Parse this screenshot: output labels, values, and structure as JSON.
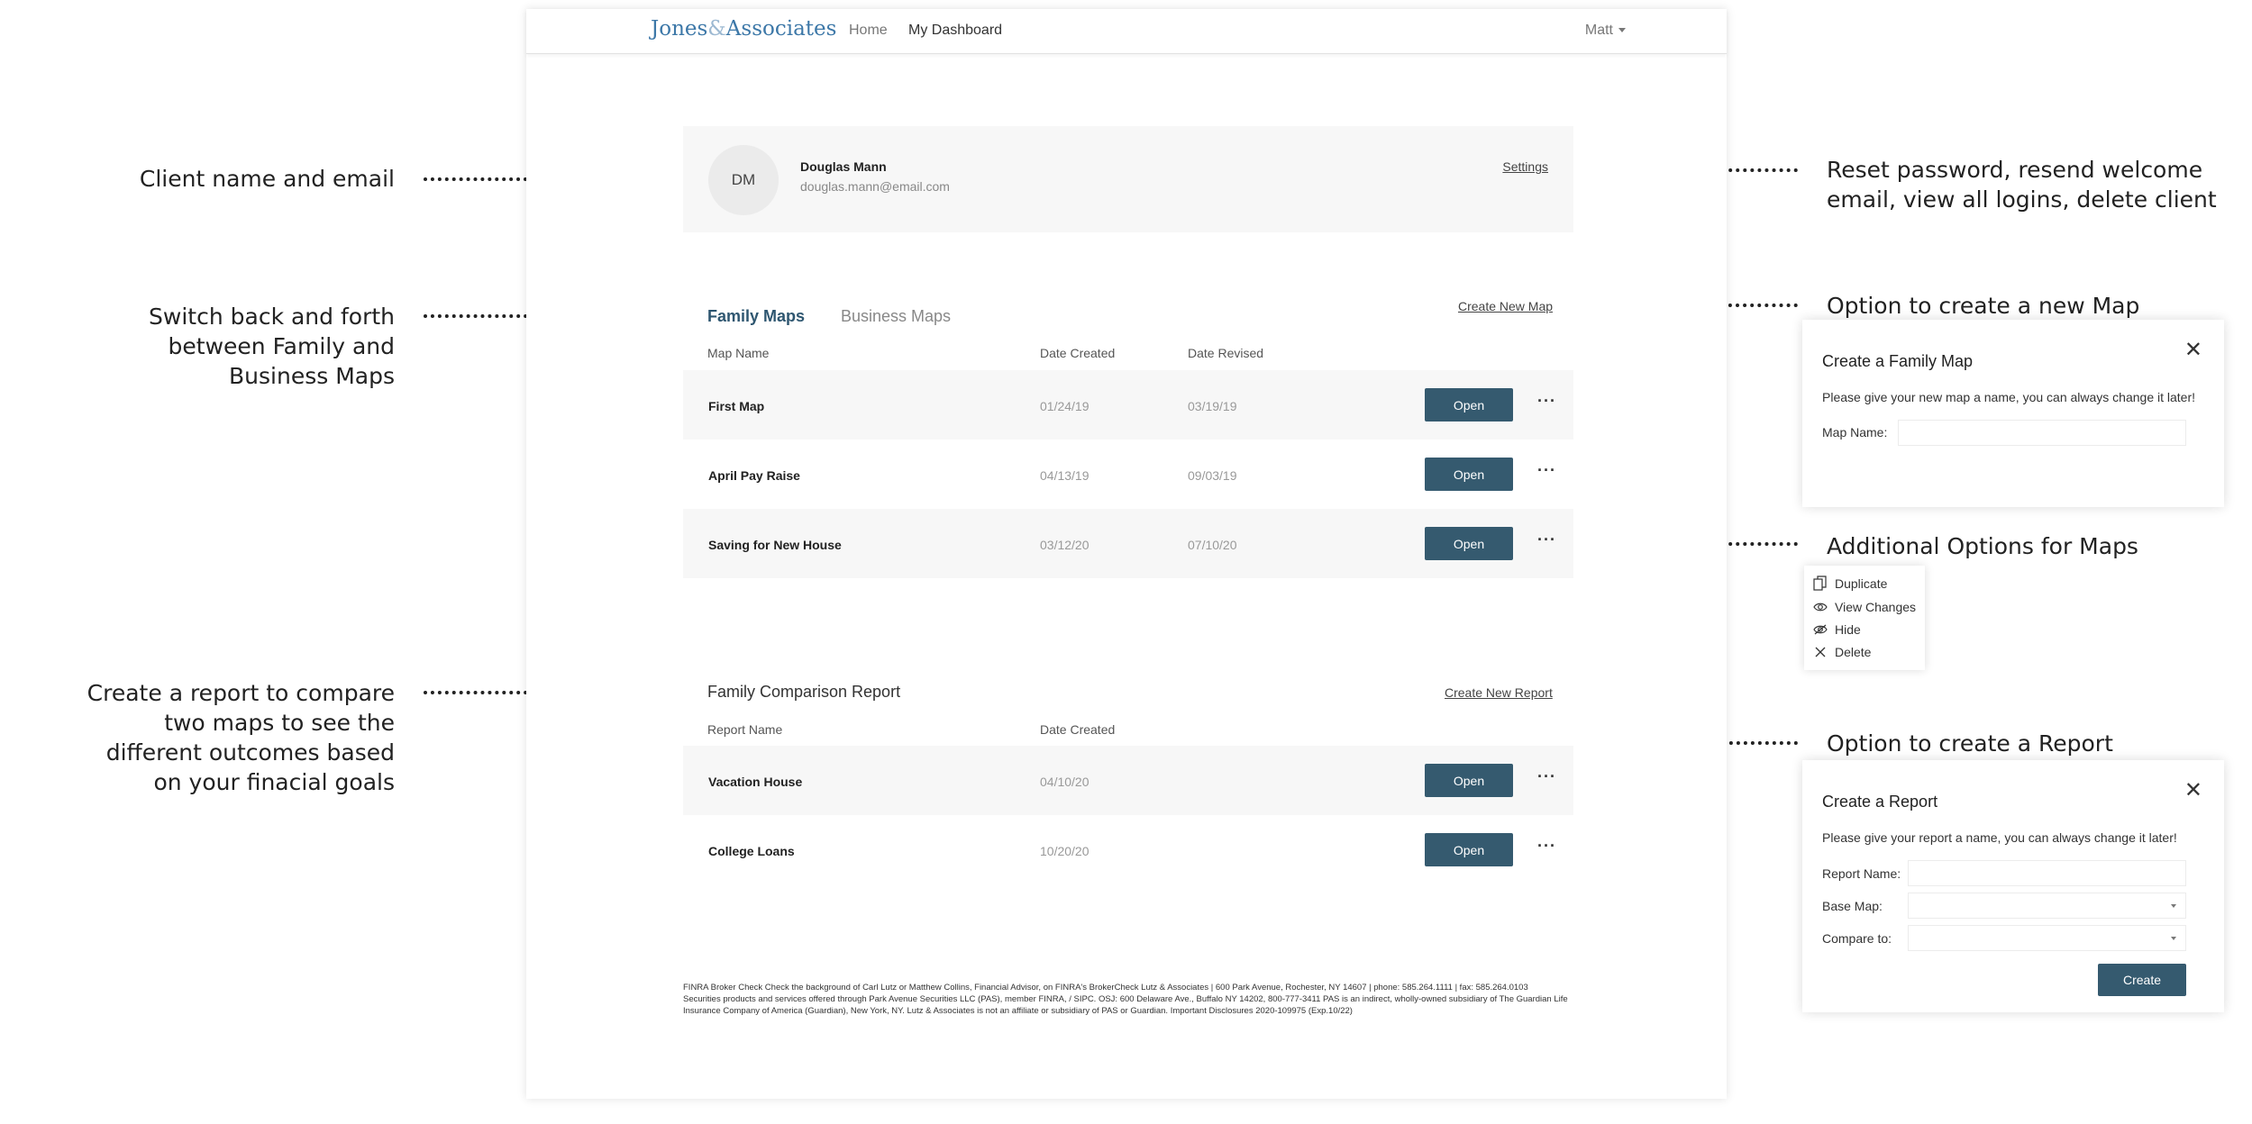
{
  "annotations": {
    "client": "Client name and email",
    "switch": [
      "Switch back and forth",
      "between Family and",
      "Business Maps"
    ],
    "report": [
      "Create a report to compare",
      "two maps to see the",
      "different outcomes based",
      "on your finacial goals"
    ],
    "settings": [
      "Reset password, resend welcome",
      "email, view all logins, delete client"
    ],
    "new_map": "Option to create a new Map",
    "options": "Additional Options for Maps",
    "new_report": "Option to create a Report"
  },
  "header": {
    "logo_left": "Jones",
    "logo_amp": "&",
    "logo_right": "Associates",
    "nav_home": "Home",
    "nav_dashboard": "My Dashboard",
    "user": "Matt"
  },
  "client": {
    "initials": "DM",
    "name": "Douglas Mann",
    "email": "douglas.mann@email.com",
    "settings_link": "Settings"
  },
  "maps": {
    "tab_family": "Family Maps",
    "tab_business": "Business Maps",
    "create_link": "Create New Map",
    "col_name": "Map Name",
    "col_created": "Date Created",
    "col_revised": "Date Revised",
    "rows": [
      {
        "name": "First Map",
        "created": "01/24/19",
        "revised": "03/19/19"
      },
      {
        "name": "April Pay Raise",
        "created": "04/13/19",
        "revised": "09/03/19"
      },
      {
        "name": "Saving for New House",
        "created": "03/12/20",
        "revised": "07/10/20"
      }
    ],
    "open_label": "Open",
    "more_label": "···"
  },
  "reports": {
    "title": "Family Comparison Report",
    "create_link": "Create New Report",
    "col_name": "Report Name",
    "col_created": "Date Created",
    "rows": [
      {
        "name": "Vacation House",
        "created": "04/10/20"
      },
      {
        "name": "College Loans",
        "created": "10/20/20"
      }
    ],
    "open_label": "Open",
    "more_label": "···"
  },
  "footer": {
    "line1": "FINRA Broker Check Check the background of Carl Lutz or Matthew Collins, Financial Advisor, on FINRA's BrokerCheck Lutz & Associates | 600 Park Avenue, Rochester, NY 14607 | phone: 585.264.1111 | fax: 585.264.0103",
    "line2": "Securities products and services offered through Park Avenue Securities LLC (PAS), member FINRA, / SIPC. OSJ: 600 Delaware Ave., Buffalo NY 14202, 800-777-3411 PAS is an indirect, wholly-owned subsidiary of The Guardian Life",
    "line3": "Insurance Company of America (Guardian), New York, NY. Lutz & Associates is not an affiliate or subsidiary of PAS or Guardian. Important Disclosures 2020-109975 (Exp.10/22)"
  },
  "map_modal": {
    "title": "Create a Family Map",
    "close": "✕",
    "text": "Please give your new map a name, you can always change it later!",
    "label": "Map Name:",
    "value": ""
  },
  "menu": {
    "items": [
      "Duplicate",
      "View Changes",
      "Hide",
      "Delete"
    ]
  },
  "report_modal": {
    "title": "Create a Report",
    "close": "✕",
    "text": "Please give your report a name, you can always change it later!",
    "label_name": "Report Name:",
    "label_base": "Base Map:",
    "label_compare": "Compare to:",
    "create_label": "Create"
  }
}
